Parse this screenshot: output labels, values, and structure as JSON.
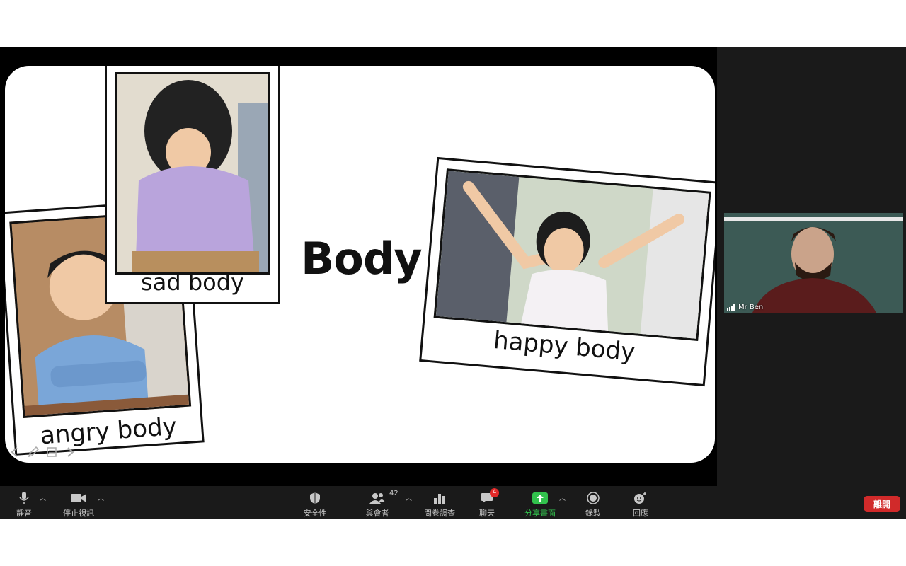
{
  "slide": {
    "title": "Body",
    "cards": [
      {
        "id": "angry",
        "caption": "angry body"
      },
      {
        "id": "sad",
        "caption": "sad body"
      },
      {
        "id": "happy",
        "caption": "happy body"
      }
    ]
  },
  "participant": {
    "name": "Mr Ben"
  },
  "toolbar": {
    "mute": "靜音",
    "stop_video": "停止視訊",
    "security": "安全性",
    "participants": "與會者",
    "participants_count": "42",
    "polls": "問卷調查",
    "chat": "聊天",
    "chat_badge": "4",
    "share_screen": "分享畫面",
    "record": "錄製",
    "reactions": "回應",
    "leave": "離開"
  },
  "colors": {
    "share_green": "#32c24d",
    "leave_red": "#d12a2a",
    "badge_red": "#e02828"
  }
}
